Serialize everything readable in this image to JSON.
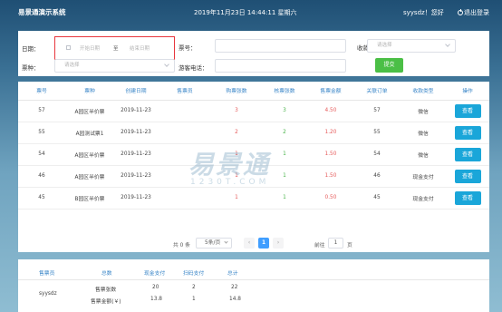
{
  "header": {
    "app_title": "易景通演示系统",
    "datetime": "2019年11月23日 14:44:11 星期六",
    "user_greeting": "syysdz！您好",
    "logout_label": "退出登录"
  },
  "filters": {
    "date_label": "日期：",
    "date_start_placeholder": "开始日期",
    "date_separator": "至",
    "date_end_placeholder": "结束日期",
    "ticket_no_label": "票号：",
    "ticket_no_value": "",
    "payment_type_label": "收款类型：",
    "payment_type_placeholder": "请选择",
    "ticket_type_label": "票种：",
    "ticket_type_placeholder": "请选择",
    "visitor_phone_label": "游客电话：",
    "visitor_phone_value": "",
    "submit_label": "提交"
  },
  "table": {
    "columns": [
      "票号",
      "票种",
      "创建日期",
      "售票员",
      "购票张数",
      "核票张数",
      "售票金额",
      "关联订单",
      "收款类型",
      "操作"
    ],
    "rows": [
      {
        "no": "57",
        "type": "A园区半价票",
        "date": "2019-11-23",
        "seller": "",
        "qty": "3",
        "checked": "3",
        "amount": "4.50",
        "order": "57",
        "pay": "微信",
        "action": "查看"
      },
      {
        "no": "55",
        "type": "A园测试票1",
        "date": "2019-11-23",
        "seller": "",
        "qty": "2",
        "checked": "2",
        "amount": "1.20",
        "order": "55",
        "pay": "微信",
        "action": "查看"
      },
      {
        "no": "54",
        "type": "A园区半价票",
        "date": "2019-11-23",
        "seller": "",
        "qty": "1",
        "checked": "1",
        "amount": "1.50",
        "order": "54",
        "pay": "微信",
        "action": "查看"
      },
      {
        "no": "46",
        "type": "A园区半价票",
        "date": "2019-11-23",
        "seller": "",
        "qty": "1",
        "checked": "1",
        "amount": "1.50",
        "order": "46",
        "pay": "现金支付",
        "action": "查看"
      },
      {
        "no": "45",
        "type": "B园区半价票",
        "date": "2019-11-23",
        "seller": "",
        "qty": "1",
        "checked": "1",
        "amount": "0.50",
        "order": "45",
        "pay": "现金支付",
        "action": "查看"
      }
    ]
  },
  "pagination": {
    "total_text": "共 0 条",
    "page_size": "5条/页",
    "prev": "‹",
    "current_page": "1",
    "next": "›",
    "goto_label": "前往",
    "goto_value": "1",
    "goto_unit": "页"
  },
  "watermark": {
    "cn": "易景通",
    "en": "1230T.COM"
  },
  "summary": {
    "columns": [
      "售票员",
      "总数",
      "现金支付",
      "扫码支付",
      "总计"
    ],
    "seller": "syysdz",
    "rows": [
      {
        "label": "售票张数",
        "cash": "20",
        "scan": "2",
        "total": "22"
      },
      {
        "label": "售票金额(￥)",
        "cash": "13.8",
        "scan": "1",
        "total": "14.8"
      }
    ]
  },
  "colors": {
    "header_text": "#3a86c8",
    "accent_blue": "#1aa6d9",
    "submit_green": "#4bbf46",
    "highlight_red": "#e8363d"
  }
}
